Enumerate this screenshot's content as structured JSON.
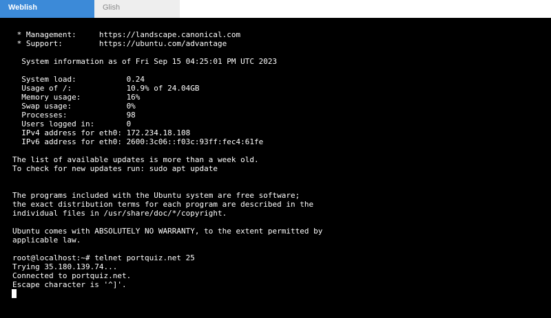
{
  "tabs": [
    {
      "label": "Weblish",
      "active": true
    },
    {
      "label": "Glish",
      "active": false
    }
  ],
  "colors": {
    "tab_active_bg": "#3c8ad8",
    "tab_inactive_bg": "#eeeeee",
    "terminal_bg": "#000000",
    "terminal_fg": "#ffffff"
  },
  "terminal": {
    "lines": [
      " * Management:     https://landscape.canonical.com",
      " * Support:        https://ubuntu.com/advantage",
      "",
      "  System information as of Fri Sep 15 04:25:01 PM UTC 2023",
      "",
      "  System load:           0.24",
      "  Usage of /:            10.9% of 24.04GB",
      "  Memory usage:          16%",
      "  Swap usage:            0%",
      "  Processes:             98",
      "  Users logged in:       0",
      "  IPv4 address for eth0: 172.234.18.108",
      "  IPv6 address for eth0: 2600:3c06::f03c:93ff:fec4:61fe",
      "",
      "The list of available updates is more than a week old.",
      "To check for new updates run: sudo apt update",
      "",
      "",
      "The programs included with the Ubuntu system are free software;",
      "the exact distribution terms for each program are described in the",
      "individual files in /usr/share/doc/*/copyright.",
      "",
      "Ubuntu comes with ABSOLUTELY NO WARRANTY, to the extent permitted by",
      "applicable law.",
      "",
      "root@localhost:~# telnet portquiz.net 25",
      "Trying 35.180.139.74...",
      "Connected to portquiz.net.",
      "Escape character is '^]'."
    ]
  }
}
